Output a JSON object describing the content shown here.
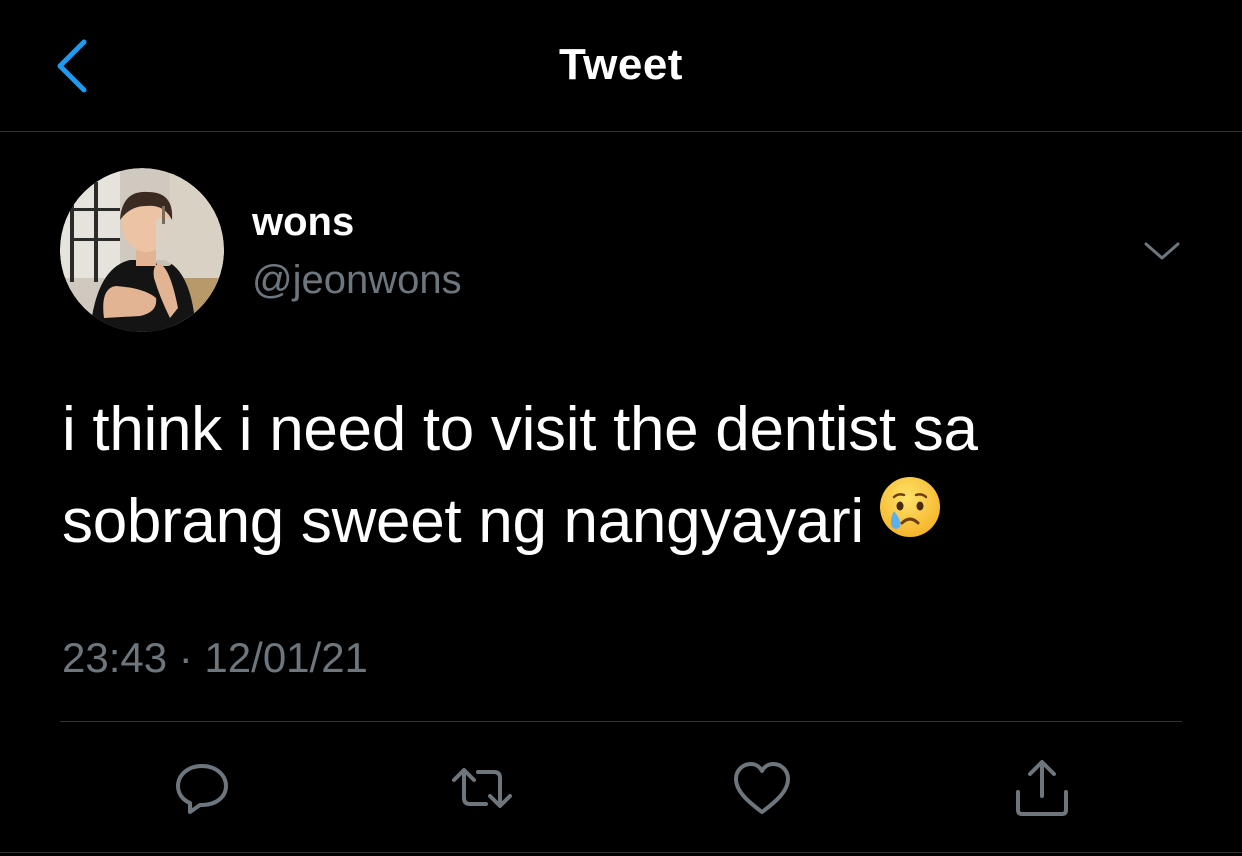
{
  "header": {
    "title": "Tweet",
    "back_icon": "chevron-left-icon"
  },
  "tweet": {
    "author": {
      "display_name": "wons",
      "handle": "@jeonwons"
    },
    "text_line_1": "i think i need to visit the dentist sa",
    "text_line_2": "sobrang sweet ng nangyayari",
    "emoji": "crying-face",
    "timestamp": "23:43 · 12/01/21"
  },
  "actions": [
    {
      "icon": "reply-icon"
    },
    {
      "icon": "retweet-icon"
    },
    {
      "icon": "like-icon"
    },
    {
      "icon": "share-icon"
    }
  ],
  "colors": {
    "accent": "#1d9bf0",
    "secondary_text": "#6e767d",
    "divider": "#2f3336",
    "background": "#000000"
  }
}
